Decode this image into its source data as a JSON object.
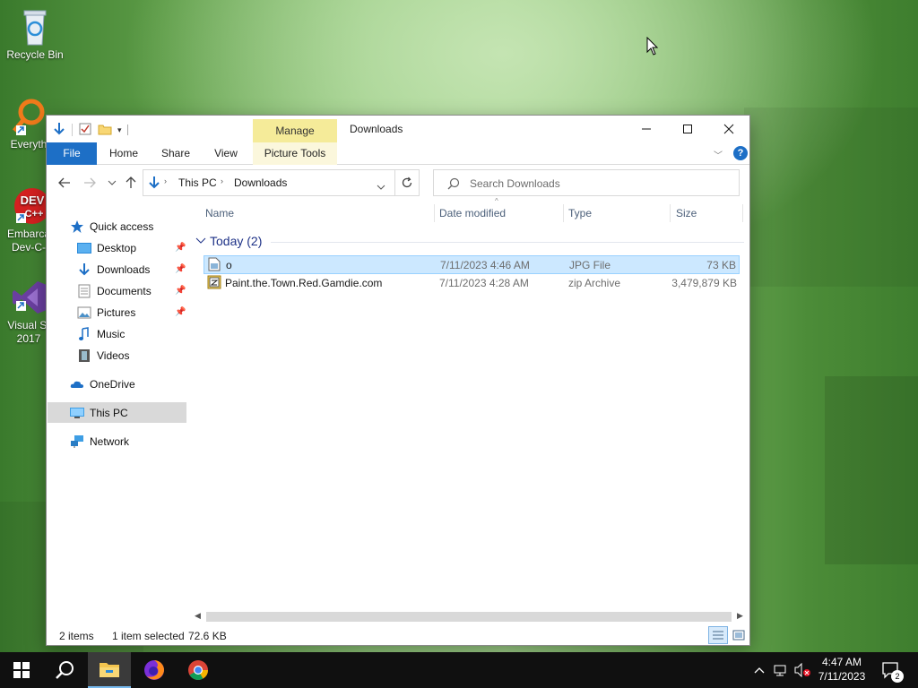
{
  "desktop": {
    "icons": [
      {
        "label": "Recycle Bin"
      },
      {
        "label": "Everyth"
      },
      {
        "label_line1": "Embarca",
        "label_line2": "Dev-C-"
      },
      {
        "label_line1": "Visual St",
        "label_line2": "2017"
      }
    ]
  },
  "window": {
    "title": "Downloads",
    "context_tab_group": "Manage",
    "controls": {
      "minimize": "—",
      "maximize": "☐",
      "close": "✕"
    },
    "ribbon_tabs": [
      "File",
      "Home",
      "Share",
      "View",
      "Picture Tools"
    ],
    "help": "?",
    "address": {
      "crumbs": [
        "This PC",
        "Downloads"
      ]
    },
    "search": {
      "placeholder": "Search Downloads"
    },
    "nav": {
      "quick_access": "Quick access",
      "items": [
        "Desktop",
        "Downloads",
        "Documents",
        "Pictures",
        "Music",
        "Videos"
      ],
      "onedrive": "OneDrive",
      "this_pc": "This PC",
      "network": "Network"
    },
    "columns": [
      "Name",
      "Date modified",
      "Type",
      "Size"
    ],
    "group": "Today (2)",
    "files": [
      {
        "name": "o",
        "date": "7/11/2023 4:46 AM",
        "type": "JPG File",
        "size": "73 KB",
        "selected": true
      },
      {
        "name": "Paint.the.Town.Red.Gamdie.com",
        "date": "7/11/2023 4:28 AM",
        "type": "zip Archive",
        "size": "3,479,879 KB",
        "selected": false
      }
    ],
    "status": {
      "count": "2 items",
      "selection": "1 item selected",
      "size": "72.6 KB"
    }
  },
  "taskbar": {
    "clock": {
      "time": "4:47 AM",
      "date": "7/11/2023"
    },
    "notification_count": "2"
  },
  "colors": {
    "accent": "#1d6fc6",
    "selection": "#cce8ff",
    "manage_tab": "#f5eb99"
  }
}
